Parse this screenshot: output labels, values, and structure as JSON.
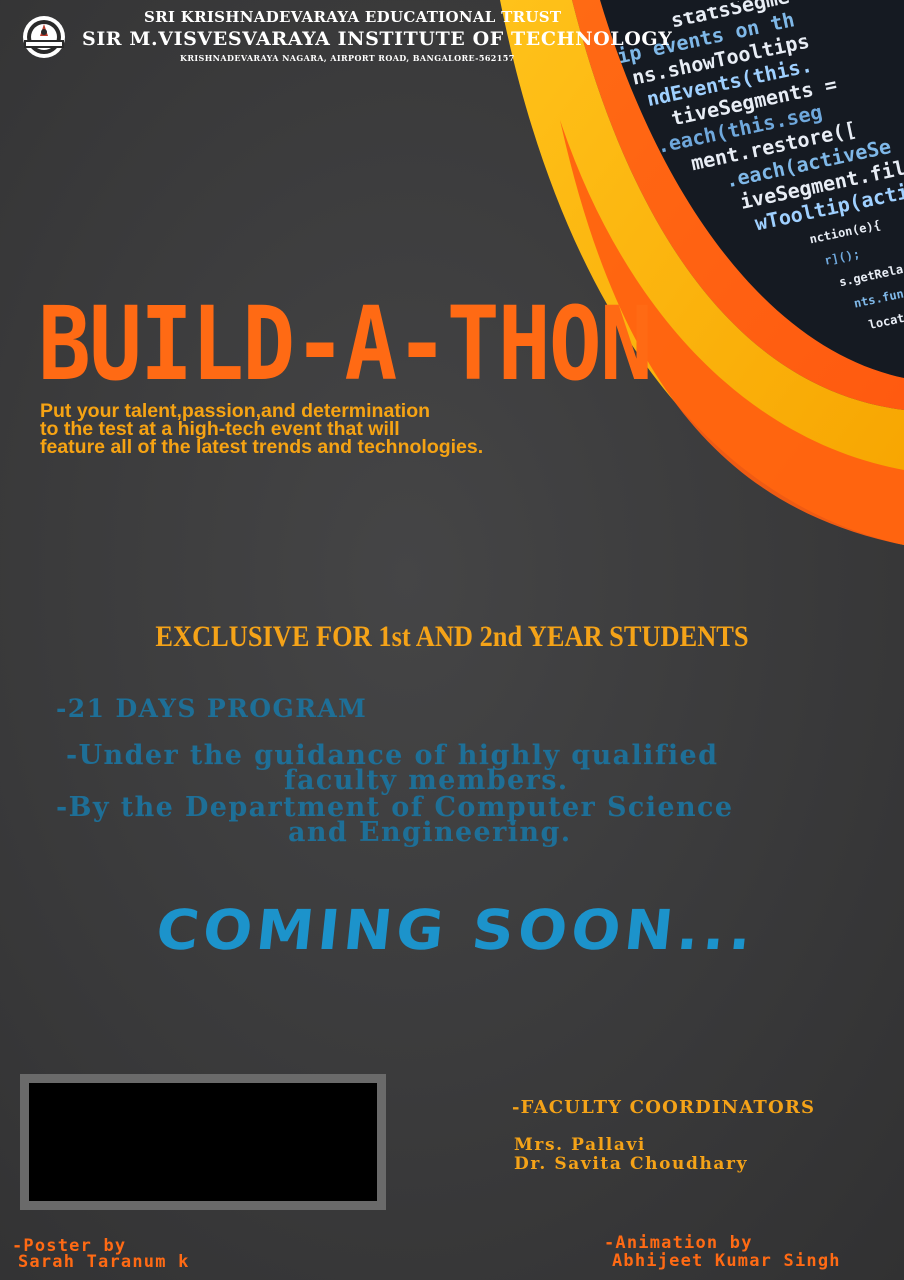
{
  "header": {
    "trust_name": "SRI KRISHNADEVARAYA EDUCATIONAL TRUST",
    "institute_name": "SIR M.VISVESVARAYA INSTITUTE OF TECHNOLOGY",
    "address": "KRISHNADEVARAYA NAGARA, AIRPORT ROAD, BANGALORE-562157"
  },
  "event": {
    "title": "BUILD-A-THON",
    "tagline_lines": [
      "Put your talent,passion,and determination",
      "to the test at a high-tech event that will",
      "feature all of the latest trends and technologies."
    ]
  },
  "eligibility": "EXCLUSIVE FOR 1st AND 2nd YEAR STUDENTS",
  "details": {
    "duration": "-21 DAYS PROGRAM",
    "guidance_line1": "-Under the guidance of highly qualified",
    "guidance_line2": "faculty members.",
    "department_line1": "-By the Department of Computer Science",
    "department_line2": "and Engineering."
  },
  "announcement": "COMING SOON...",
  "coordinators": {
    "heading": "-FACULTY COORDINATORS",
    "names": [
      "Mrs. Pallavi",
      "Dr. Savita Choudhary"
    ]
  },
  "credits": {
    "poster_label": "-Poster by",
    "poster_name": "Sarah Taranum k",
    "animation_label": "-Animation by",
    "animation_name": "Abhijeet Kumar Singh"
  },
  "code_snippet_lines": [
    "statsSegme",
    "ip events on th",
    "ns.showTooltips",
    "ndEvents(this.",
    "tiveSegments =",
    ".each(this.seg",
    "ment.restore([",
    ".each(activeSe",
    "iveSegment.fil",
    "wTooltip(activ",
    "nction(e){",
    "r]();",
    "s.getRela",
    "nts.fun",
    "locati"
  ],
  "colors": {
    "background": "#3a3a3b",
    "title_orange": "#ff6a14",
    "tagline_yellow": "#f6a313",
    "detail_blue": "#1e6f97",
    "coming_soon_blue": "#1c93cb",
    "code_panel": "#151a22"
  },
  "icons": {
    "logo": "institute-emblem-icon"
  }
}
